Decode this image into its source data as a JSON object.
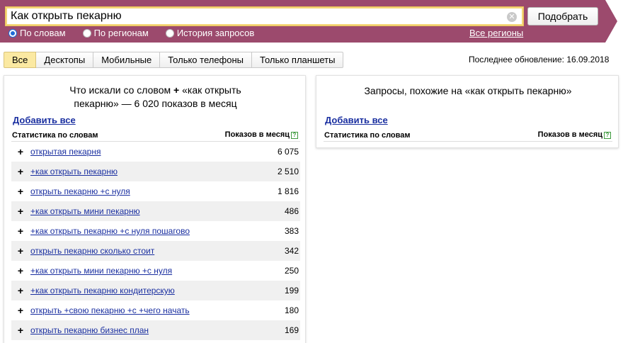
{
  "search": {
    "query": "Как открыть пекарню",
    "clear_glyph": "✕",
    "submit_label": "Подобрать",
    "modes": [
      {
        "label": "По словам",
        "checked": true
      },
      {
        "label": "По регионам",
        "checked": false
      },
      {
        "label": "История запросов",
        "checked": false
      }
    ],
    "regions_link": "Все регионы"
  },
  "tabs": [
    {
      "label": "Все",
      "active": true
    },
    {
      "label": "Десктопы",
      "active": false
    },
    {
      "label": "Мобильные",
      "active": false
    },
    {
      "label": "Только телефоны",
      "active": false
    },
    {
      "label": "Только планшеты",
      "active": false
    }
  ],
  "last_update": "Последнее обновление: 16.09.2018",
  "left_panel": {
    "title_line1_a": "Что искали со словом",
    "title_plus": "+",
    "title_line1_b": "«как открыть",
    "title_line2": "пекарню» — 6 020 показов в месяц",
    "add_all": "Добавить все",
    "col_words": "Статистика по словам",
    "col_count": "Показов в месяц",
    "help_glyph": "?",
    "row_plus": "+",
    "rows": [
      {
        "phrase": "открытая пекарня",
        "count": "6 075"
      },
      {
        "phrase": "+как открыть пекарню",
        "count": "2 510"
      },
      {
        "phrase": "открыть пекарню +с нуля",
        "count": "1 816"
      },
      {
        "phrase": "+как открыть мини пекарню",
        "count": "486"
      },
      {
        "phrase": "+как открыть пекарню +с нуля пошагово",
        "count": "383"
      },
      {
        "phrase": "открыть пекарню сколько стоит",
        "count": "342"
      },
      {
        "phrase": "+как открыть мини пекарню +с нуля",
        "count": "250"
      },
      {
        "phrase": "+как открыть пекарню кондитерскую",
        "count": "199"
      },
      {
        "phrase": "открыть +свою пекарню +с +чего начать",
        "count": "180"
      },
      {
        "phrase": "открыть пекарню бизнес план",
        "count": "169"
      }
    ]
  },
  "right_panel": {
    "title": "Запросы, похожие на «как открыть пекарню»",
    "add_all": "Добавить все",
    "col_words": "Статистика по словам",
    "col_count": "Показов в месяц",
    "help_glyph": "?"
  },
  "colors": {
    "header_band": "#9c4a6d",
    "link": "#1a2fa0",
    "active_tab": "#fbe9a2"
  }
}
